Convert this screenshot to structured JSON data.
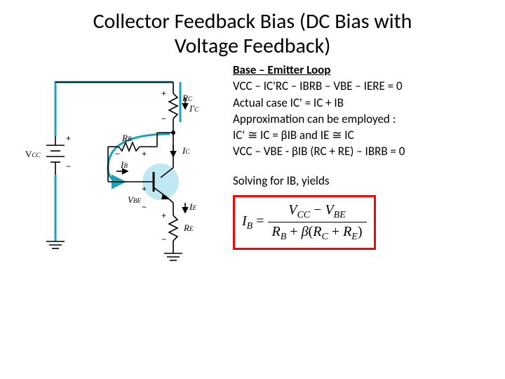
{
  "title_line1": "Collector Feedback Bias (DC Bias with",
  "title_line2": "Voltage Feedback)",
  "eq": {
    "heading": "Base – Emitter Loop",
    "l1": "VCC – IC'RC – IBRB – VBE – IERE = 0",
    "l2": "Actual case IC' = IC + IB",
    "l3": "Approximation can be employed :",
    "l4": "IC' ≅ IC = βIB and IE ≅ IC",
    "l5": "VCC – VBE - βIB (RC + RE) – IBRB = 0",
    "solve": "Solving for IB, yields",
    "formula_lhs": "IB",
    "formula_num1": "VCC",
    "formula_minus": "−",
    "formula_num2": "VBE",
    "formula_den_rb": "RB",
    "formula_den_plus": "+",
    "formula_den_beta": "β",
    "formula_den_open": "(",
    "formula_den_rc": "RC",
    "formula_den_plus2": "+",
    "formula_den_re": "RE",
    "formula_den_close": ")"
  },
  "circuit_labels": {
    "vcc": "VCC",
    "rc": "RC",
    "icprime": "I'C",
    "rb": "RB",
    "ib": "IB",
    "ic": "IC",
    "vbe": "VBE",
    "ie": "IE",
    "re": "RE",
    "plus": "+",
    "minus": "−"
  }
}
